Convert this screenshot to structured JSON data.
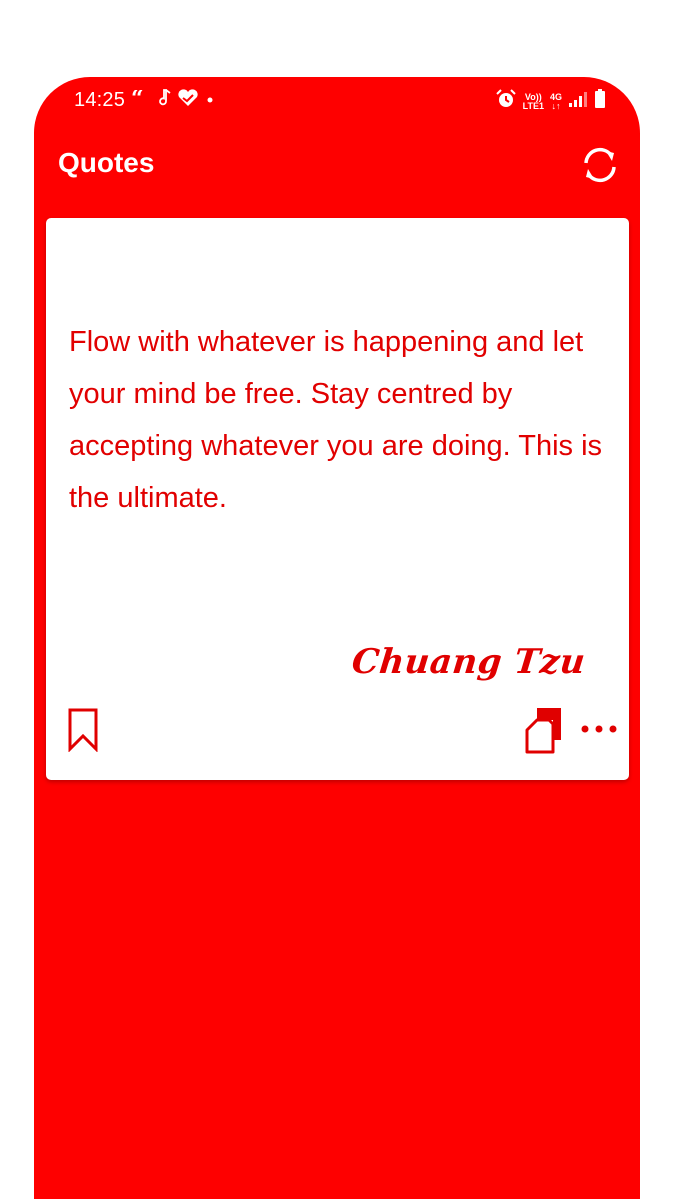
{
  "status_bar": {
    "time": "14:25",
    "network_top": "Vo))",
    "network_bottom": "LTE1",
    "network_type": "4G",
    "icons": [
      "quote-mark-icon",
      "music-note-icon",
      "heart-check-icon",
      "dot-icon",
      "alarm-icon",
      "signal-icon",
      "battery-icon"
    ]
  },
  "app_bar": {
    "title": "Quotes",
    "refresh_icon": "refresh-icon"
  },
  "quote_card": {
    "text": "Flow with whatever is happening and let your mind be free. Stay centred by accepting whatever you are doing. This is the ultimate.",
    "author": "Chuang Tzu",
    "actions": [
      "bookmark-icon",
      "copy-icon",
      "more-options-icon"
    ]
  },
  "colors": {
    "background": "#fe0000",
    "card": "#ffffff",
    "accent_text": "#e10000"
  }
}
